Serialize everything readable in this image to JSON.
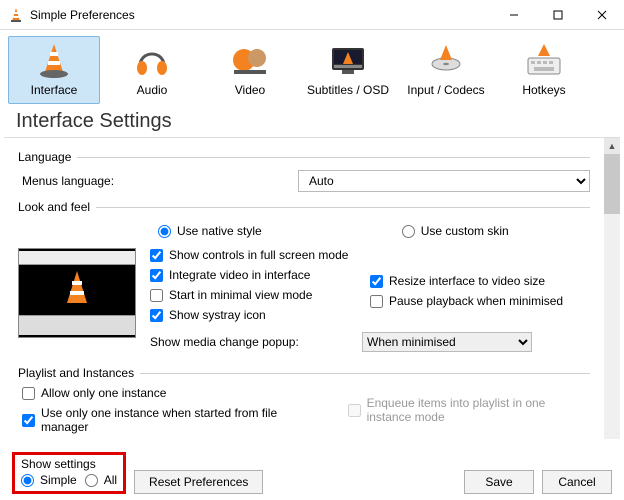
{
  "window": {
    "title": "Simple Preferences"
  },
  "tabs": [
    {
      "key": "interface",
      "label": "Interface"
    },
    {
      "key": "audio",
      "label": "Audio"
    },
    {
      "key": "video",
      "label": "Video"
    },
    {
      "key": "subtitles",
      "label": "Subtitles / OSD"
    },
    {
      "key": "input",
      "label": "Input / Codecs"
    },
    {
      "key": "hotkeys",
      "label": "Hotkeys"
    }
  ],
  "page": {
    "title": "Interface Settings"
  },
  "language": {
    "header": "Language",
    "menus_label": "Menus language:",
    "value": "Auto"
  },
  "lookfeel": {
    "header": "Look and feel",
    "native": "Use native style",
    "custom": "Use custom skin",
    "show_controls": "Show controls in full screen mode",
    "integrate_video": "Integrate video in interface",
    "start_minimal": "Start in minimal view mode",
    "systray": "Show systray icon",
    "resize_interface": "Resize interface to video size",
    "pause_minimised": "Pause playback when minimised",
    "popup_label": "Show media change popup:",
    "popup_value": "When minimised"
  },
  "playlist": {
    "header": "Playlist and Instances",
    "allow_one": "Allow only one instance",
    "enqueue": "Enqueue items into playlist in one instance mode",
    "one_from_fm": "Use only one instance when started from file manager"
  },
  "footer": {
    "show_settings": "Show settings",
    "simple": "Simple",
    "all": "All",
    "reset": "Reset Preferences",
    "save": "Save",
    "cancel": "Cancel"
  }
}
